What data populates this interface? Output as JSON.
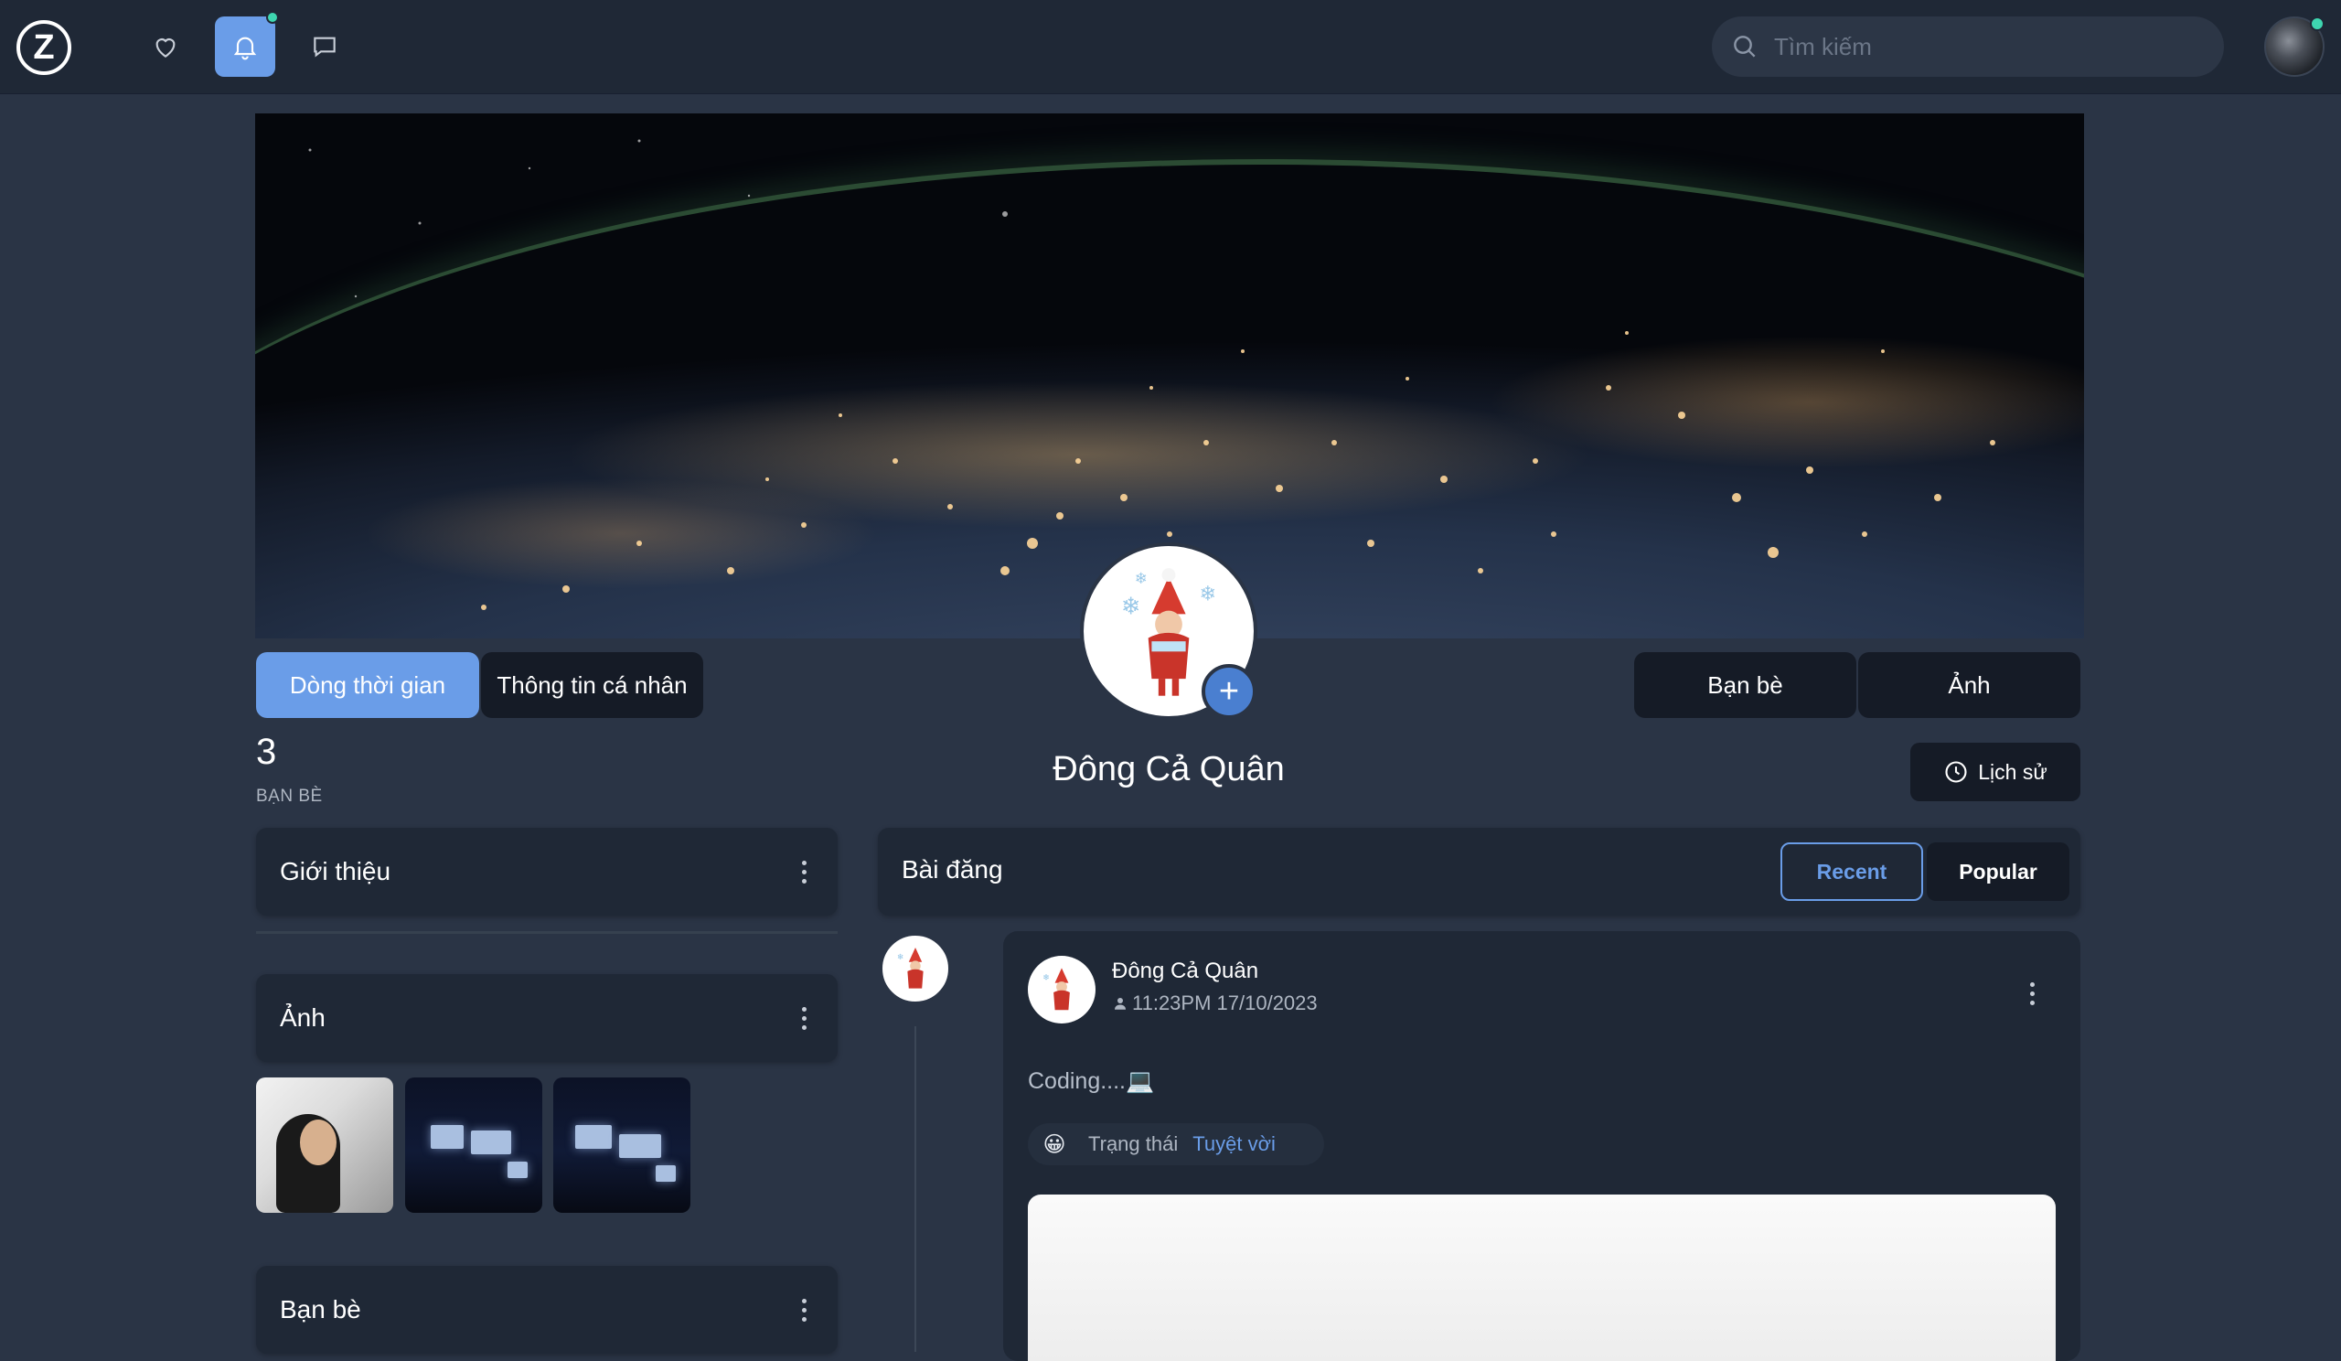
{
  "topbar": {
    "logo_letter": "Z",
    "nav": [
      {
        "icon": "heart-icon",
        "active": false
      },
      {
        "icon": "bell-icon",
        "active": true,
        "has_dot": true
      },
      {
        "icon": "chat-icon",
        "active": false
      }
    ],
    "search_placeholder": "Tìm kiếm",
    "search_value": "",
    "accent_color": "#6a9de8",
    "online_color": "#3ed6b0"
  },
  "profile": {
    "tabs": [
      {
        "label": "Dòng thời gian",
        "active": true
      },
      {
        "label": "Thông tin cá nhân",
        "active": false
      },
      {
        "label": "Bạn bè",
        "active": false
      },
      {
        "label": "Ảnh",
        "active": false
      }
    ],
    "name": "Đông Cả Quân",
    "friends_count": "3",
    "friends_label": "BẠN BÈ",
    "history_label": "Lịch sử",
    "add_avatar_symbol": "+"
  },
  "sidebar": {
    "intro_title": "Giới thiệu",
    "photos_title": "Ảnh",
    "friends_title": "Bạn bè"
  },
  "posts": {
    "title": "Bài đăng",
    "sort_recent": "Recent",
    "sort_popular": "Popular",
    "items": [
      {
        "author": "Đông Cả Quân",
        "time": "11:23PM 17/10/2023",
        "text": "Coding....💻",
        "status_emoji": "😀",
        "status_label": "Trạng thái",
        "status_value": "Tuyệt vời"
      }
    ]
  }
}
